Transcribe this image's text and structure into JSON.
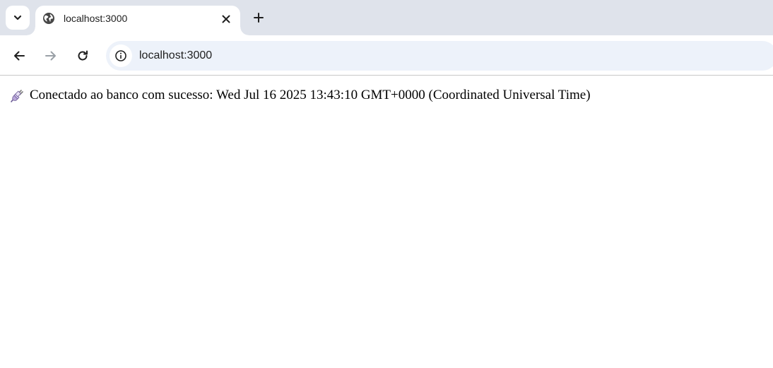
{
  "browser": {
    "tab": {
      "title": "localhost:3000",
      "favicon": "globe-icon"
    },
    "icons": {
      "tab_search": "chevron-down-icon",
      "close": "close-icon",
      "new_tab": "plus-icon",
      "back": "arrow-left-icon",
      "forward": "arrow-right-icon",
      "reload": "reload-icon",
      "site_info": "info-icon"
    },
    "address": {
      "url": "localhost:3000"
    },
    "colors": {
      "tabstrip_bg": "#dfe3eb",
      "omnibox_bg": "#edf2fa",
      "icon": "#1f1f1f",
      "icon_disabled": "#9aa0a6"
    }
  },
  "page": {
    "message": {
      "icon": "electric-plug-emoji",
      "text": "Conectado ao banco com sucesso: Wed Jul 16 2025 13:43:10 GMT+0000 (Coordinated Universal Time)"
    }
  }
}
